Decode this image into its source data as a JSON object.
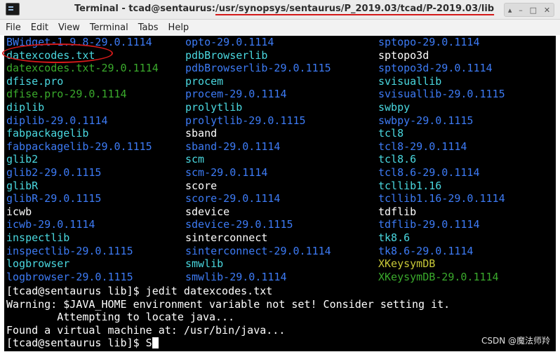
{
  "window": {
    "title_prefix": "Terminal - tcad@sentaurus:",
    "title_path": "/usr/synopsys/sentaurus/P_2019.03/tcad/P-2019.03/lib",
    "controls": [
      "▴",
      "–",
      "□",
      "✕"
    ]
  },
  "menu": [
    "File",
    "Edit",
    "View",
    "Terminal",
    "Tabs",
    "Help"
  ],
  "listing": [
    [
      "BWidget-1.9.8-29.0.1114",
      "opto-29.0.1114",
      "sptopo-29.0.1114"
    ],
    [
      "datexcodes.txt",
      "pdbBrowserlib",
      "sptopo3d"
    ],
    [
      "datexcodes.txt-29.0.1114",
      "pdbBrowserlib-29.0.1115",
      "sptopo3d-29.0.1114"
    ],
    [
      "dfise.pro",
      "procem",
      "svisuallib"
    ],
    [
      "dfise.pro-29.0.1114",
      "procem-29.0.1114",
      "svisuallib-29.0.1115"
    ],
    [
      "diplib",
      "prolytlib",
      "swbpy"
    ],
    [
      "diplib-29.0.1114",
      "prolytlib-29.0.1115",
      "swbpy-29.0.1115"
    ],
    [
      "fabpackagelib",
      "sband",
      "tcl8"
    ],
    [
      "fabpackagelib-29.0.1115",
      "sband-29.0.1114",
      "tcl8-29.0.1114"
    ],
    [
      "glib2",
      "scm",
      "tcl8.6"
    ],
    [
      "glib2-29.0.1115",
      "scm-29.0.1114",
      "tcl8.6-29.0.1114"
    ],
    [
      "glibR",
      "score",
      "tcllib1.16"
    ],
    [
      "glibR-29.0.1115",
      "score-29.0.1114",
      "tcllib1.16-29.0.1114"
    ],
    [
      "icwb",
      "sdevice",
      "tdflib"
    ],
    [
      "icwb-29.0.1114",
      "sdevice-29.0.1115",
      "tdflib-29.0.1114"
    ],
    [
      "inspectlib",
      "sinterconnect",
      "tk8.6"
    ],
    [
      "inspectlib-29.0.1115",
      "sinterconnect-29.0.1114",
      "tk8.6-29.0.1114"
    ],
    [
      "logbrowser",
      "smwlib",
      "XKeysymDB"
    ],
    [
      "logbrowser-29.0.1115",
      "smwlib-29.0.1114",
      "XKeysymDB-29.0.1114"
    ]
  ],
  "listing_colors": [
    [
      "dir",
      "dir",
      "dir"
    ],
    [
      "cyan",
      "cyan",
      "exe"
    ],
    [
      "green",
      "dir",
      "dir"
    ],
    [
      "cyan",
      "cyan",
      "cyan"
    ],
    [
      "green",
      "dir",
      "dir"
    ],
    [
      "cyan",
      "cyan",
      "cyan"
    ],
    [
      "dir",
      "dir",
      "dir"
    ],
    [
      "cyan",
      "exe",
      "cyan"
    ],
    [
      "dir",
      "dir",
      "dir"
    ],
    [
      "cyan",
      "cyan",
      "cyan"
    ],
    [
      "dir",
      "dir",
      "dir"
    ],
    [
      "cyan",
      "exe",
      "cyan"
    ],
    [
      "dir",
      "dir",
      "dir"
    ],
    [
      "exe",
      "exe",
      "exe"
    ],
    [
      "dir",
      "dir",
      "dir"
    ],
    [
      "cyan",
      "exe",
      "cyan"
    ],
    [
      "dir",
      "dir",
      "dir"
    ],
    [
      "cyan",
      "cyan",
      "yellow"
    ],
    [
      "dir",
      "dir",
      "green"
    ]
  ],
  "output": [
    "[tcad@sentaurus lib]$ jedit datexcodes.txt",
    "Warning: $JAVA_HOME environment variable not set! Consider setting it.",
    "        Attempting to locate java...",
    "Found a virtual machine at: /usr/bin/java..."
  ],
  "prompt": {
    "text": "[tcad@sentaurus lib]$ S"
  },
  "colors": {
    "exe": "#ffffff",
    "dir": "#3d7bf5",
    "cyan": "#4ad8e0",
    "green": "#3aaa2c",
    "yellow": "#c8c838",
    "annotation_red": "#d41a1a"
  },
  "watermark": "CSDN @魔法师羚"
}
